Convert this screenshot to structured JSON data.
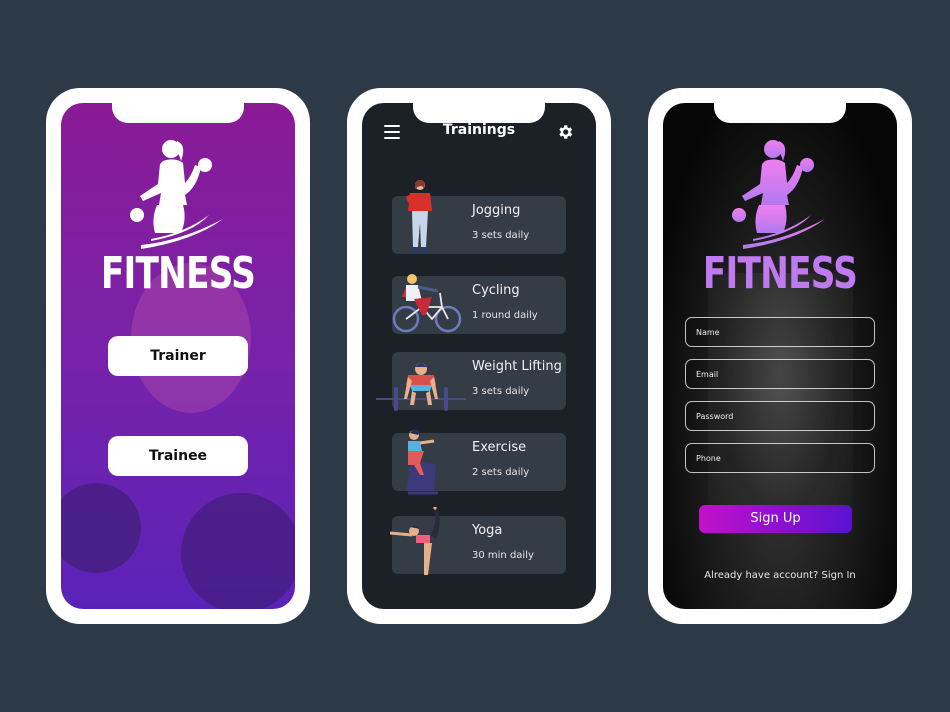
{
  "background_color": "#2c3a48",
  "screens": {
    "role_select": {
      "logo_text": "FITNESS",
      "logo_color": "#ffffff",
      "buttons": [
        {
          "label": "Trainer"
        },
        {
          "label": "Trainee"
        }
      ],
      "overlay_colors": [
        "#8a1a95",
        "#5a23b8"
      ]
    },
    "trainings": {
      "title": "Trainings",
      "menu_icon": "hamburger-menu-icon",
      "settings_icon": "gear-icon",
      "items": [
        {
          "name": "Jogging",
          "detail": "3 sets daily",
          "illustration": "jogging-woman-illustration"
        },
        {
          "name": "Cycling",
          "detail": "1 round daily",
          "illustration": "cycling-woman-illustration"
        },
        {
          "name": "Weight Lifting",
          "detail": "3 sets daily",
          "illustration": "weightlifter-illustration"
        },
        {
          "name": "Exercise",
          "detail": "2 sets daily",
          "illustration": "exercise-bike-illustration"
        },
        {
          "name": "Yoga",
          "detail": "30 min daily",
          "illustration": "yoga-pose-illustration"
        }
      ]
    },
    "signup": {
      "logo_text": "FITNESS",
      "logo_gradient": [
        "#f07ef0",
        "#b27af0"
      ],
      "fields": [
        {
          "placeholder": "Name"
        },
        {
          "placeholder": "Email"
        },
        {
          "placeholder": "Password"
        },
        {
          "placeholder": "Phone"
        }
      ],
      "submit_label": "Sign Up",
      "submit_gradient": [
        "#c311c9",
        "#5a12d2"
      ],
      "signin_prompt": "Already have account? Sign In"
    }
  }
}
